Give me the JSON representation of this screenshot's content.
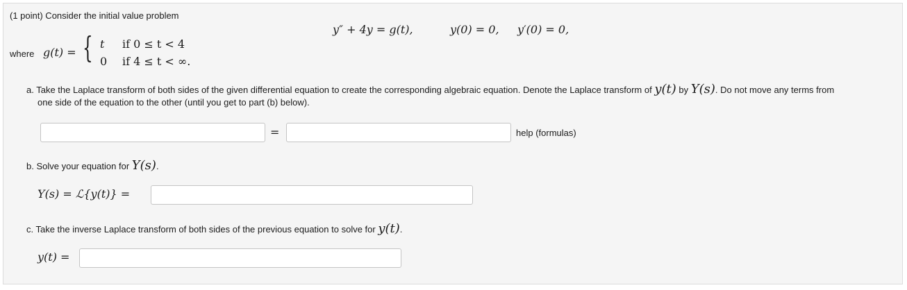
{
  "header": {
    "intro": "(1 point) Consider the initial value problem"
  },
  "problem": {
    "ode": "y″ + 4y = g(t),",
    "ic1": "y(0) = 0,",
    "ic2": "y′(0) = 0,",
    "where_label": "where",
    "g_def": "g(t) =",
    "case1_val": "t",
    "case1_cond": "if 0 ≤ t < 4",
    "case2_val": "0",
    "case2_cond": "if 4 ≤ t < ∞."
  },
  "part_a": {
    "text_prefix": "a. Take the Laplace transform of both sides of the given differential equation to create the corresponding algebraic equation. Denote the Laplace transform of ",
    "y_t": "y(t)",
    "by": " by ",
    "Y_s": "Y(s)",
    "text_suffix": ". Do not move any terms from",
    "text_line2": "one side of the equation to the other (until you get to part (b) below).",
    "equals": "=",
    "left_value": "",
    "right_value": "",
    "help_label": "help (formulas)"
  },
  "part_b": {
    "text": "b. Solve your equation for ",
    "Y_s": "Y(s)",
    "period": ".",
    "label": "Y(s) = ℒ{y(t)} =",
    "value": ""
  },
  "part_c": {
    "text": "c. Take the inverse Laplace transform of both sides of the previous equation to solve for ",
    "y_t": "y(t)",
    "period": ".",
    "label": "y(t) =",
    "value": ""
  }
}
